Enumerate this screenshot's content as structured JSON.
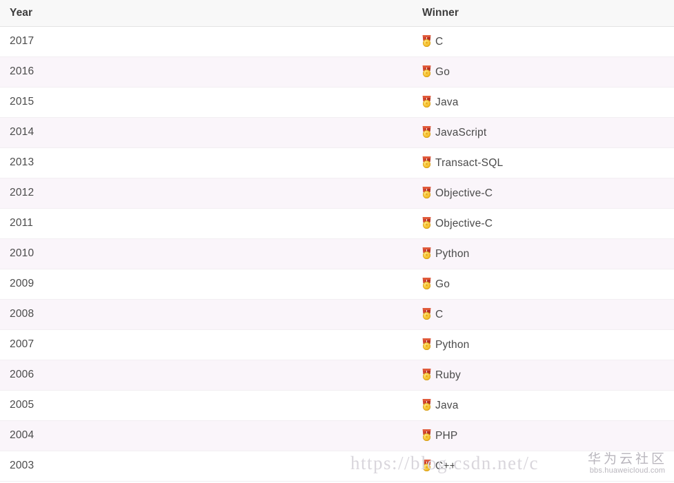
{
  "table": {
    "columns": [
      {
        "key": "year",
        "label": "Year"
      },
      {
        "key": "winner",
        "label": "Winner"
      }
    ],
    "winner_icon": "medal-icon",
    "rows": [
      {
        "year": "2017",
        "winner": "C"
      },
      {
        "year": "2016",
        "winner": "Go"
      },
      {
        "year": "2015",
        "winner": "Java"
      },
      {
        "year": "2014",
        "winner": "JavaScript"
      },
      {
        "year": "2013",
        "winner": "Transact-SQL"
      },
      {
        "year": "2012",
        "winner": "Objective-C"
      },
      {
        "year": "2011",
        "winner": "Objective-C"
      },
      {
        "year": "2010",
        "winner": "Python"
      },
      {
        "year": "2009",
        "winner": "Go"
      },
      {
        "year": "2008",
        "winner": "C"
      },
      {
        "year": "2007",
        "winner": "Python"
      },
      {
        "year": "2006",
        "winner": "Ruby"
      },
      {
        "year": "2005",
        "winner": "Java"
      },
      {
        "year": "2004",
        "winner": "PHP"
      },
      {
        "year": "2003",
        "winner": "C++"
      }
    ]
  },
  "watermarks": {
    "url": "https://blog.csdn.net/c",
    "brand_cn": "华为云社区",
    "brand_domain": "bbs.huaweicloud.com"
  },
  "colors": {
    "header_bg": "#f8f8f8",
    "row_odd_bg": "#ffffff",
    "row_even_bg": "#faf5fa",
    "text": "#4a4a4a",
    "header_text": "#3c3c3c",
    "border": "#e3e3e3",
    "medal_gold": "#f5c02c",
    "medal_ribbon": "#c0392b",
    "watermark": "#d9d6dc"
  }
}
